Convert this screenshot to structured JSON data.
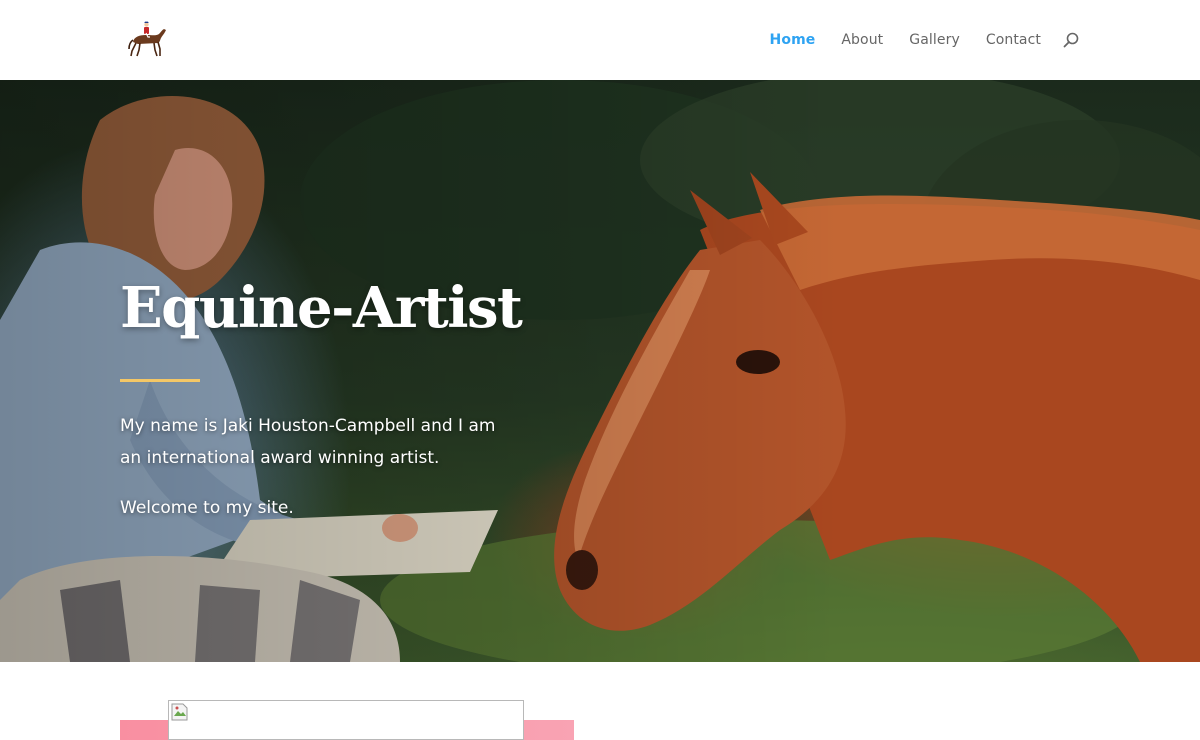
{
  "header": {
    "logo_icon": "horse-and-jockey-logo-icon",
    "nav": [
      {
        "label": "Home",
        "active": true
      },
      {
        "label": "About",
        "active": false
      },
      {
        "label": "Gallery",
        "active": false
      },
      {
        "label": "Contact",
        "active": false
      }
    ],
    "search_icon": "search-icon",
    "active_color": "#2ea3f2",
    "link_color": "#666666"
  },
  "hero": {
    "title": "Equine-Artist",
    "intro": "My name is Jaki Houston-Campbell and I am an international award winning artist.",
    "welcome": "Welcome to my site.",
    "divider_color": "#f4c766",
    "image": "artist-sketching-beside-chestnut-horse-photo"
  },
  "content": {
    "broken_image_icon": "broken-image-icon",
    "band_color": "#f98fa1"
  }
}
